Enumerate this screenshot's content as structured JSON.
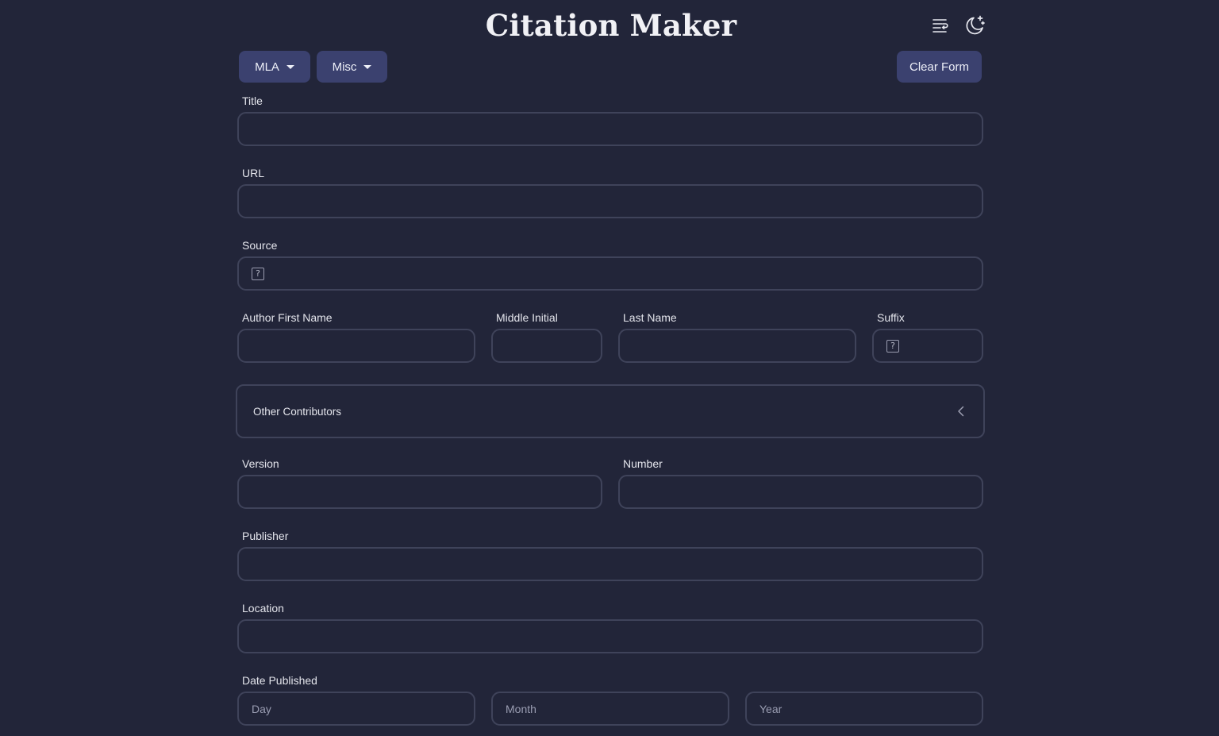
{
  "header": {
    "title": "Citation Maker",
    "icons": [
      "text-format-icon",
      "moon-stars-icon"
    ]
  },
  "toolbar": {
    "style_label": "MLA",
    "type_label": "Misc",
    "clear_label": "Clear Form"
  },
  "form": {
    "title": {
      "label": "Title",
      "value": ""
    },
    "url": {
      "label": "URL",
      "value": ""
    },
    "source": {
      "label": "Source",
      "value": "",
      "help_icon": "question-icon"
    },
    "author": {
      "first_name_label": "Author First Name",
      "middle_initial_label": "Middle Initial",
      "last_name_label": "Last Name",
      "suffix_label": "Suffix"
    },
    "other_contributors_label": "Other Contributors",
    "version": {
      "label": "Version",
      "value": ""
    },
    "number": {
      "label": "Number",
      "value": ""
    },
    "publisher": {
      "label": "Publisher",
      "value": ""
    },
    "location": {
      "label": "Location",
      "value": ""
    },
    "date_published": {
      "label": "Date Published",
      "day_placeholder": "Day",
      "month_placeholder": "Month",
      "year_placeholder": "Year"
    }
  },
  "colors": {
    "background": "#222539",
    "button": "#3b416f",
    "field_border": "#3f435a",
    "text": "#e6e7ee"
  }
}
